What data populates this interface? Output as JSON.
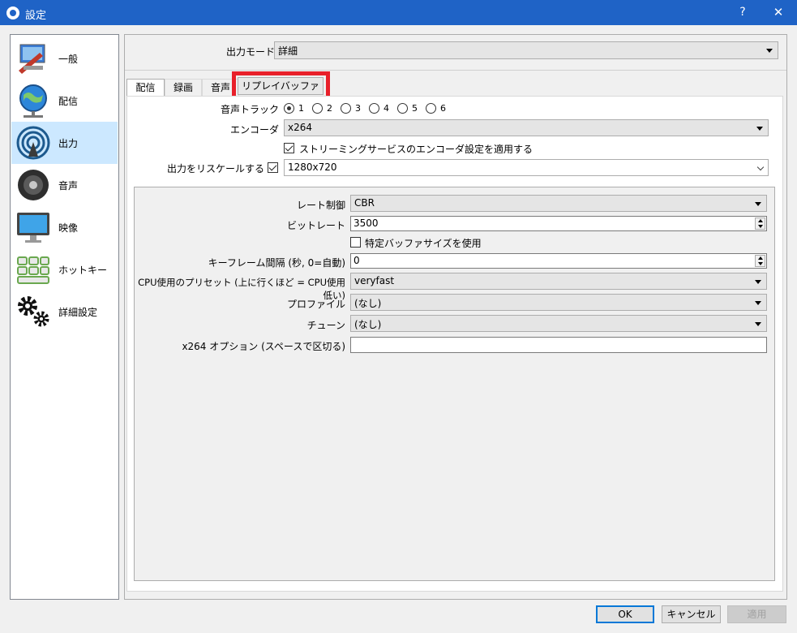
{
  "window": {
    "title": "設定",
    "help": "?",
    "close": "✕"
  },
  "sidebar": {
    "items": [
      {
        "label": "一般",
        "icon": "general-icon"
      },
      {
        "label": "配信",
        "icon": "stream-icon"
      },
      {
        "label": "出力",
        "icon": "output-icon",
        "active": true
      },
      {
        "label": "音声",
        "icon": "audio-icon"
      },
      {
        "label": "映像",
        "icon": "video-icon"
      },
      {
        "label": "ホットキー",
        "icon": "hotkey-icon"
      },
      {
        "label": "詳細設定",
        "icon": "advanced-icon"
      }
    ]
  },
  "output": {
    "mode_label": "出力モード",
    "mode_value": "詳細",
    "tabs": [
      "配信",
      "録画",
      "音声",
      "リプレイバッファー"
    ],
    "active_tab": "配信"
  },
  "stream": {
    "audio_track_label": "音声トラック",
    "audio_tracks": [
      "1",
      "2",
      "3",
      "4",
      "5",
      "6"
    ],
    "selected_track": "1",
    "encoder_label": "エンコーダ",
    "encoder_value": "x264",
    "enforce_label": "ストリーミングサービスのエンコーダ設定を適用する",
    "enforce_checked": true,
    "rescale_label": "出力をリスケールする",
    "rescale_checked": true,
    "rescale_value": "1280x720",
    "rate_control_label": "レート制御",
    "rate_control_value": "CBR",
    "bitrate_label": "ビットレート",
    "bitrate_value": "3500",
    "custom_buffer_label": "特定バッファサイズを使用",
    "custom_buffer_checked": false,
    "keyframe_label": "キーフレーム間隔 (秒, 0=自動)",
    "keyframe_value": "0",
    "preset_label": "CPU使用のプリセット (上に行くほど = CPU使用低い)",
    "preset_value": "veryfast",
    "profile_label": "プロファイル",
    "profile_value": "(なし)",
    "tune_label": "チューン",
    "tune_value": "(なし)",
    "x264opts_label": "x264 オプション (スペースで区切る)",
    "x264opts_value": ""
  },
  "buttons": {
    "ok": "OK",
    "cancel": "キャンセル",
    "apply": "適用"
  },
  "colors": {
    "titlebar": "#1f63c6",
    "highlight": "#e8202a",
    "active_item": "#cce8ff"
  }
}
